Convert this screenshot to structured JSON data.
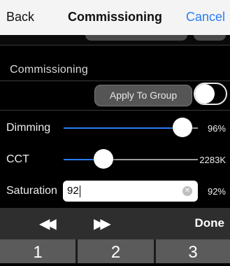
{
  "navbar": {
    "back_label": "Back",
    "title": "Commissioning",
    "cancel_label": "Cancel"
  },
  "section": {
    "header": "Commissioning",
    "apply_to_group_label": "Apply To Group",
    "apply_to_group_on": false
  },
  "dimming": {
    "label": "Dimming",
    "value_text": "96%",
    "level": 0.96
  },
  "cct": {
    "label": "CCT",
    "value_text": "2283K"
  },
  "saturation": {
    "label": "Saturation",
    "input_value": "92",
    "value_text": "92%"
  },
  "keyboard_toolbar": {
    "prev_icon": "rewind-icon",
    "next_icon": "fast-forward-icon",
    "done_label": "Done"
  },
  "keypad": {
    "keys": [
      "1",
      "2",
      "3"
    ]
  },
  "colors": {
    "accent": "#2b7cf7",
    "navbar_bg": "#f4f4f4",
    "background": "#000000"
  }
}
